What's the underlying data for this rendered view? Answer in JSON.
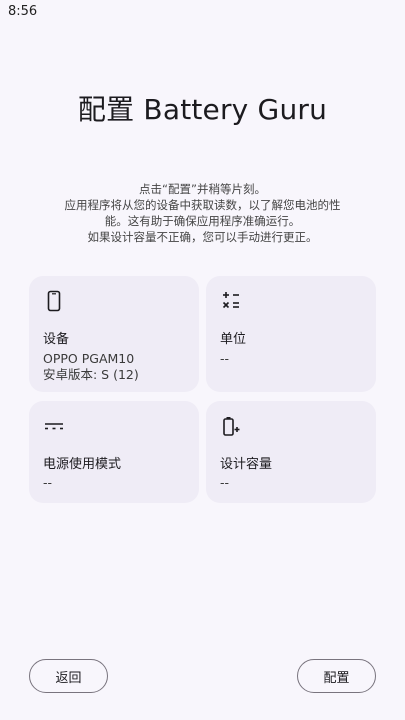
{
  "status_bar": {
    "time": "8:56"
  },
  "title": "配置 Battery Guru",
  "description": {
    "line1": "点击“配置”并稍等片刻。",
    "line2": "应用程序将从您的设备中获取读数，以了解您电池的性能。这有助于确保应用程序准确运行。",
    "line3": "如果设计容量不正确，您可以手动进行更正。"
  },
  "cards": {
    "device": {
      "icon": "phone-icon",
      "label": "设备",
      "value_line1": "OPPO PGAM10",
      "value_line2": "安卓版本: S (12)"
    },
    "unit": {
      "icon": "calculator-symbols-icon",
      "label": "单位",
      "value": "--"
    },
    "power_mode": {
      "icon": "dc-power-icon",
      "label": "电源使用模式",
      "value": "--"
    },
    "design_capacity": {
      "icon": "battery-plus-icon",
      "label": "设计容量",
      "value": "--"
    }
  },
  "buttons": {
    "back": "返回",
    "configure": "配置"
  }
}
